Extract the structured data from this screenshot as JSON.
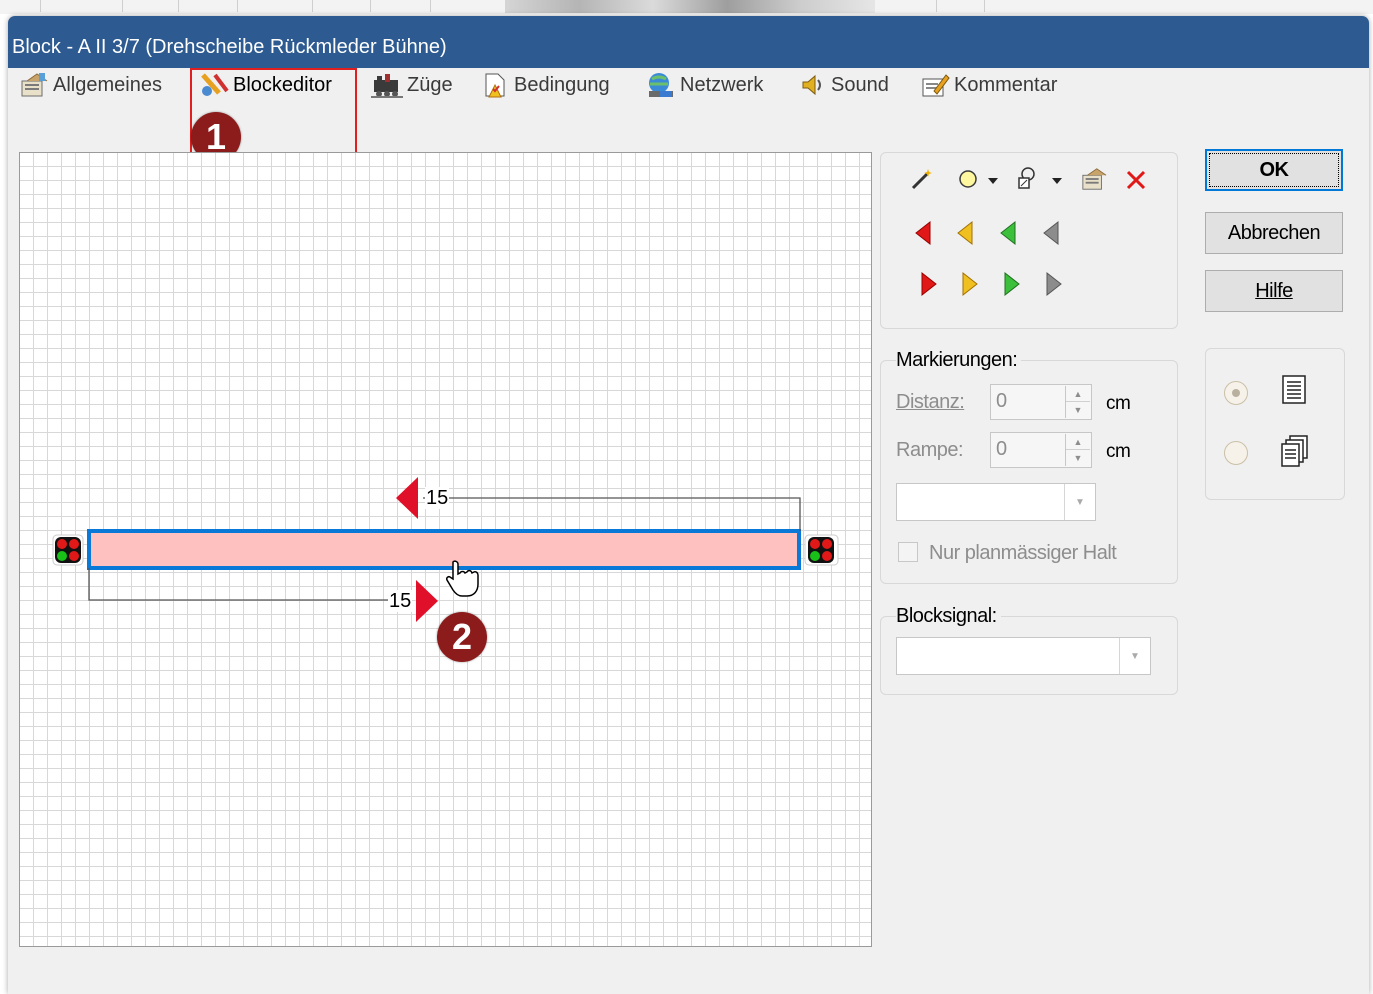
{
  "window": {
    "title": "Block - A II 3/7 (Drehscheibe Rückmleder Bühne)"
  },
  "tabs": [
    {
      "label": "Allgemeines",
      "icon": "properties-icon"
    },
    {
      "label": "Blockeditor",
      "icon": "blockeditor-icon",
      "active": true
    },
    {
      "label": "Züge",
      "icon": "train-icon"
    },
    {
      "label": "Bedingung",
      "icon": "condition-icon"
    },
    {
      "label": "Netzwerk",
      "icon": "network-icon"
    },
    {
      "label": "Sound",
      "icon": "sound-icon"
    },
    {
      "label": "Kommentar",
      "icon": "comment-icon"
    }
  ],
  "annotations": {
    "badge1": "1",
    "badge2": "2",
    "highlight_color": "#e02020",
    "badge_color": "#8c1b1b"
  },
  "editor": {
    "marker_top_value": "15",
    "marker_bottom_value": "15",
    "block_fill": "#ffc0c0",
    "block_border": "#0a78d7"
  },
  "toolbox": {
    "tools": [
      "wand-icon",
      "circle-icon",
      "dropdown-arrow-icon",
      "route-icon",
      "dropdown-arrow-icon",
      "properties-icon",
      "delete-icon"
    ],
    "left_arrows": [
      "red",
      "yellow",
      "green",
      "gray"
    ],
    "right_arrows": [
      "red",
      "yellow",
      "green",
      "gray"
    ]
  },
  "markierungen": {
    "legend": "Markierungen:",
    "distanz_label": "Distanz:",
    "distanz_value": "0",
    "distanz_unit": "cm",
    "rampe_label": "Rampe:",
    "rampe_value": "0",
    "rampe_unit": "cm",
    "halt_label": "Nur planmässiger Halt"
  },
  "blocksignal": {
    "legend": "Blocksignal:"
  },
  "buttons": {
    "ok": "OK",
    "cancel": "Abbrechen",
    "help": "Hilfe"
  },
  "view_mode": {
    "selected": "single"
  }
}
